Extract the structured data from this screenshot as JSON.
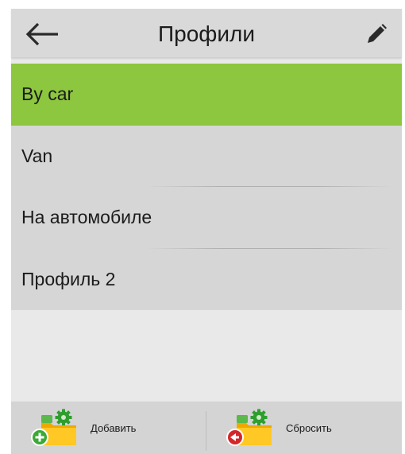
{
  "header": {
    "title": "Профили",
    "back_icon": "arrow-left-icon",
    "edit_icon": "pencil-icon"
  },
  "profiles": [
    {
      "label": "By car",
      "selected": true
    },
    {
      "label": "Van",
      "selected": false
    },
    {
      "label": "На автомобиле",
      "selected": false
    },
    {
      "label": "Профиль 2",
      "selected": false
    }
  ],
  "toolbar": {
    "add_label": "Добавить",
    "reset_label": "Сбросить"
  },
  "colors": {
    "selected": "#8dc63f",
    "add_badge": "#3aa935",
    "reset_badge": "#d3272a",
    "folder": "#f5b400",
    "gear": "#2e9e2e"
  }
}
